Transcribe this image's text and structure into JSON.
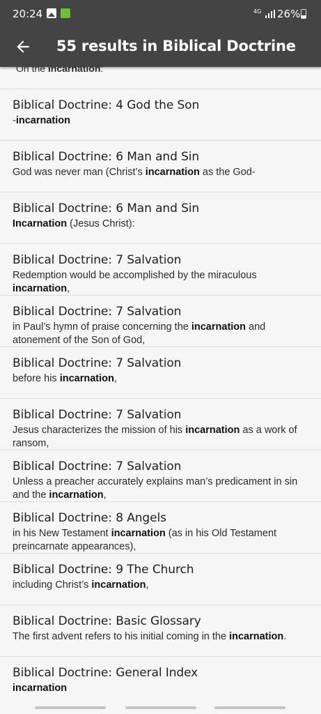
{
  "status": {
    "time": "20:24",
    "network": "4G",
    "battery": "26%"
  },
  "appbar": {
    "title": "55 results in Biblical Doctrine"
  },
  "partial_item": {
    "pre": "On the ",
    "match": "incarnation",
    "post": ":"
  },
  "results": [
    {
      "title": "Biblical Doctrine: 4 God the Son",
      "pre": "-",
      "match": "incarnation",
      "post": ""
    },
    {
      "title": "Biblical Doctrine: 6 Man and Sin",
      "pre": "God was never man (Christ’s ",
      "match": "incarnation",
      "post": " as the God-"
    },
    {
      "title": "Biblical Doctrine: 6 Man and Sin",
      "pre": "",
      "match": "Incarnation",
      "post": " (Jesus Christ):"
    },
    {
      "title": "Biblical Doctrine: 7 Salvation",
      "pre": "Redemption would be accomplished by the miraculous ",
      "match": "incarnation",
      "post": ","
    },
    {
      "title": "Biblical Doctrine: 7 Salvation",
      "pre": "in Paul’s hymn of praise concerning the ",
      "match": "incarnation",
      "post": " and atonement of the Son of God,"
    },
    {
      "title": "Biblical Doctrine: 7 Salvation",
      "pre": "before his ",
      "match": "incarnation",
      "post": ","
    },
    {
      "title": "Biblical Doctrine: 7 Salvation",
      "pre": "Jesus characterizes the mission of his ",
      "match": "incarnation",
      "post": " as a work of ransom,"
    },
    {
      "title": "Biblical Doctrine: 7 Salvation",
      "pre": "Unless a preacher accurately explains man’s predicament in sin and the ",
      "match": "incarnation",
      "post": ","
    },
    {
      "title": "Biblical Doctrine: 8 Angels",
      "pre": "in his New Testament ",
      "match": "incarnation",
      "post": " (as in his Old Testament preincarnate appearances),"
    },
    {
      "title": "Biblical Doctrine: 9 The Church",
      "pre": "including Christ’s ",
      "match": "incarnation",
      "post": ","
    },
    {
      "title": "Biblical Doctrine: Basic Glossary",
      "pre": "The first advent refers to his initial coming in the ",
      "match": "incarnation",
      "post": "."
    },
    {
      "title": "Biblical Doctrine: General Index",
      "pre": "",
      "match": "incarnation",
      "post": ""
    }
  ],
  "colors": {
    "appbar": "#444444",
    "background": "#f6f6f6",
    "divider": "#dcdcdc"
  },
  "icons": {
    "back": "arrow-left-icon"
  }
}
